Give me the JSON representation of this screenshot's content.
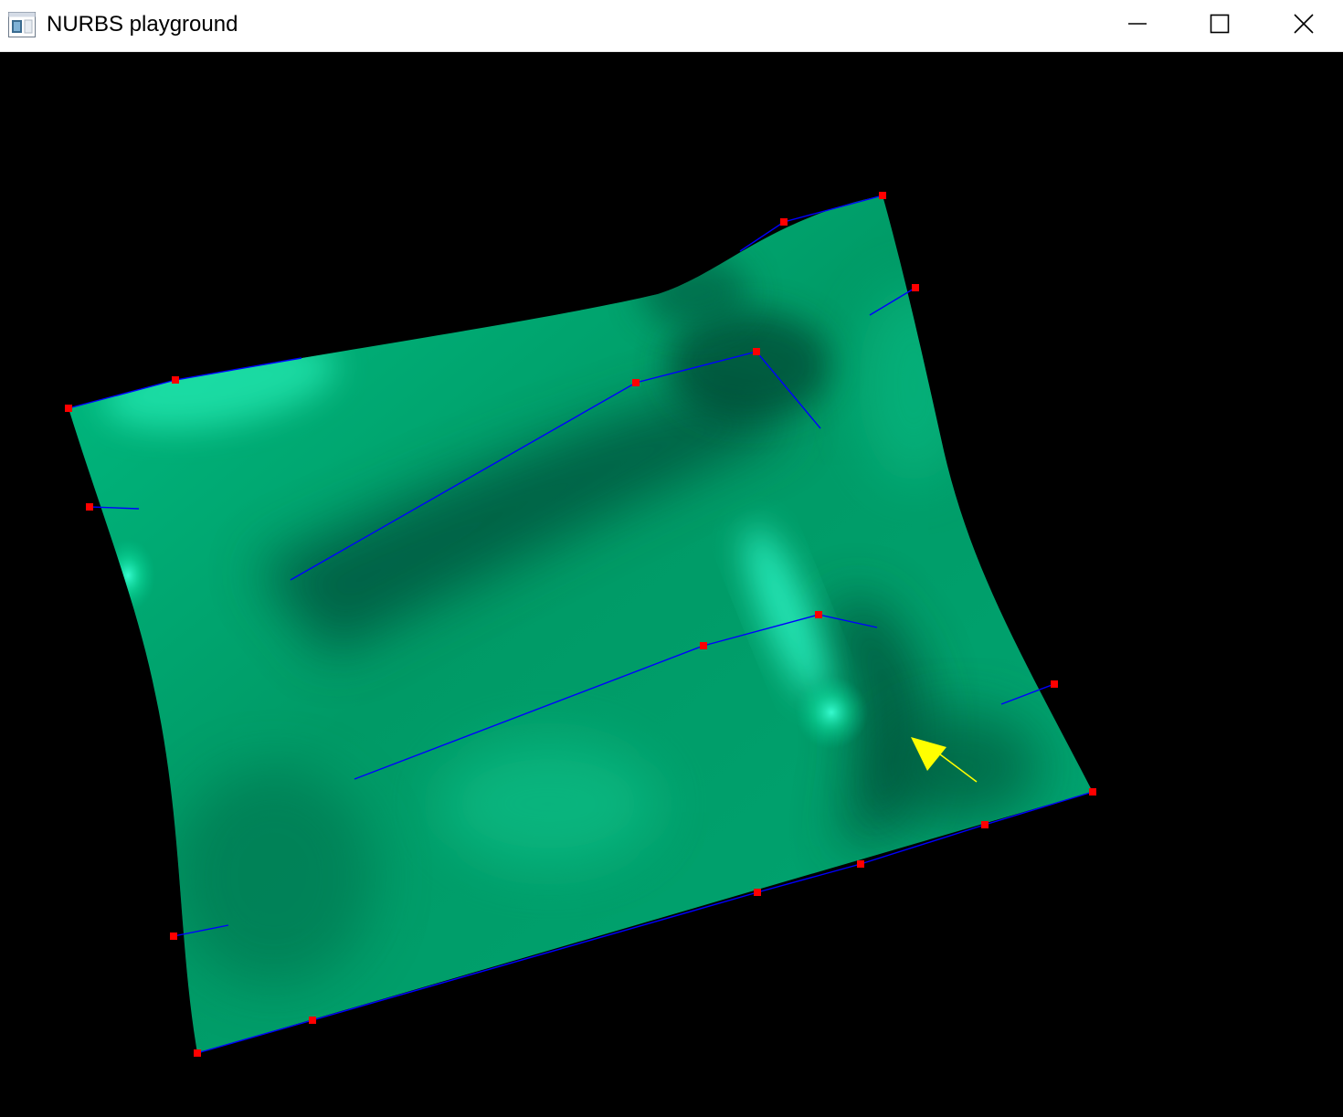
{
  "window": {
    "title": "NURBS playground"
  },
  "titlebar": {
    "icons": {
      "app": "app-window-icon",
      "minimize": "minimize-icon",
      "maximize": "maximize-icon",
      "close": "close-icon"
    }
  },
  "viewport": {
    "background_color": "#000000",
    "surface_colors": {
      "base": "#00a870",
      "highlight": "#22ffc8",
      "shadow": "#005a3c"
    },
    "control_point_color": "#ff0000",
    "control_line_color": "#0000ff",
    "pointer_color": "#ffff00"
  }
}
